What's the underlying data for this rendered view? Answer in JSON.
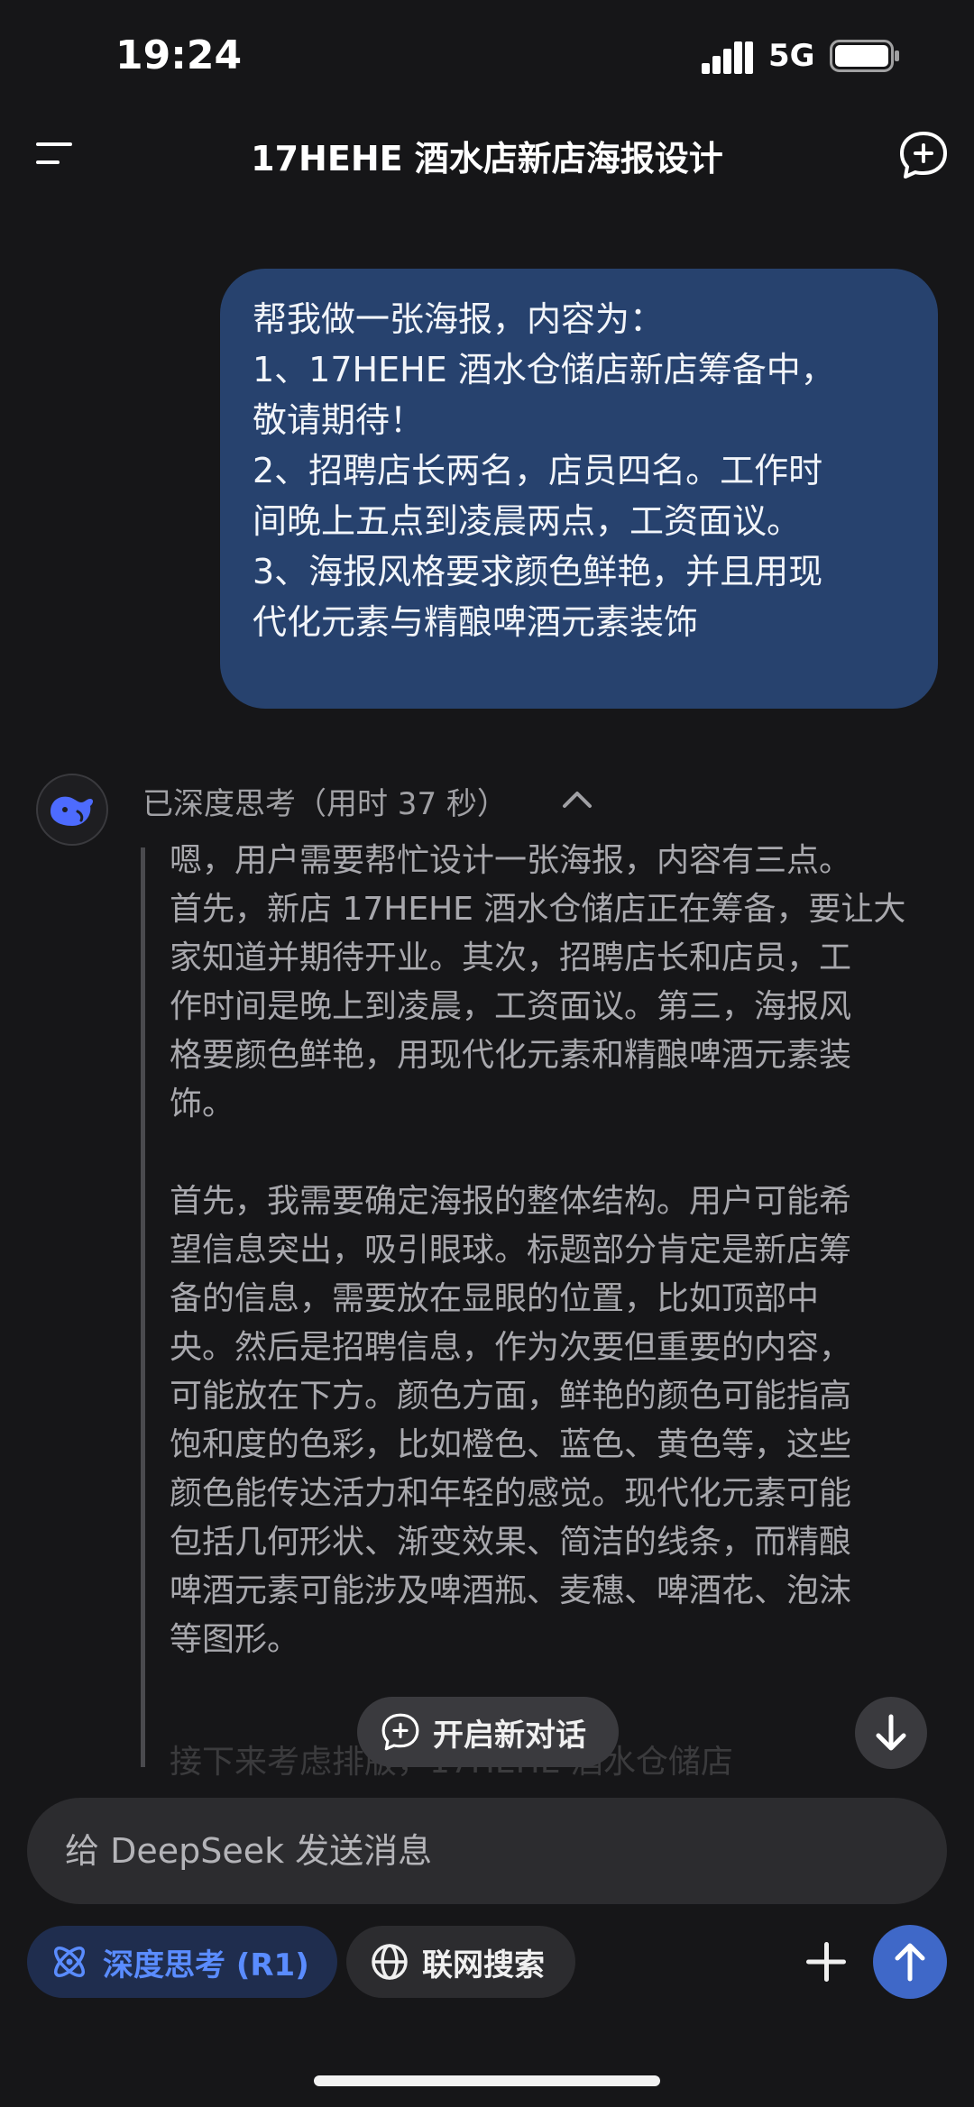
{
  "status_bar": {
    "time": "19:24",
    "network": "5G"
  },
  "header": {
    "title": "17HEHE 酒水店新店海报设计"
  },
  "user_message": {
    "lines": [
      "帮我做一张海报，内容为：",
      "1、17HEHE 酒水仓储店新店筹备中，",
      "敬请期待！",
      "2、招聘店长两名，店员四名。工作时",
      "间晚上五点到凌晨两点，工资面议。",
      "3、海报风格要求颜色鲜艳，并且用现",
      "代化元素与精酿啤酒元素装饰"
    ]
  },
  "assistant": {
    "thinking_label": "已深度思考（用时 37 秒）",
    "paragraph1": [
      "嗯，用户需要帮忙设计一张海报，内容有三点。",
      "首先，新店 17HEHE 酒水仓储店正在筹备，要让大",
      "家知道并期待开业。其次，招聘店长和店员，工",
      "作时间是晚上到凌晨，工资面议。第三，海报风",
      "格要颜色鲜艳，用现代化元素和精酿啤酒元素装",
      "饰。"
    ],
    "paragraph2": [
      "首先，我需要确定海报的整体结构。用户可能希",
      "望信息突出，吸引眼球。标题部分肯定是新店筹",
      "备的信息，需要放在显眼的位置，比如顶部中",
      "央。然后是招聘信息，作为次要但重要的内容，",
      "可能放在下方。颜色方面，鲜艳的颜色可能指高",
      "饱和度的色彩，比如橙色、蓝色、黄色等，这些",
      "颜色能传达活力和年轻的感觉。现代化元素可能",
      "包括几何形状、渐变效果、简洁的线条，而精酿",
      "啤酒元素可能涉及啤酒瓶、麦穗、啤酒花、泡沫",
      "等图形。"
    ],
    "faded_line": "接下来考虑排版，17HEHE 酒水仓储店"
  },
  "floating": {
    "new_dialog_label": "开启新对话"
  },
  "input": {
    "placeholder": "给 DeepSeek 发送消息"
  },
  "toolbar": {
    "deep_think_label": "深度思考 (R1)",
    "web_search_label": "联网搜索"
  },
  "colors": {
    "accent": "#5a8cff",
    "bubble": "#27426e",
    "send": "#3f68c8"
  }
}
